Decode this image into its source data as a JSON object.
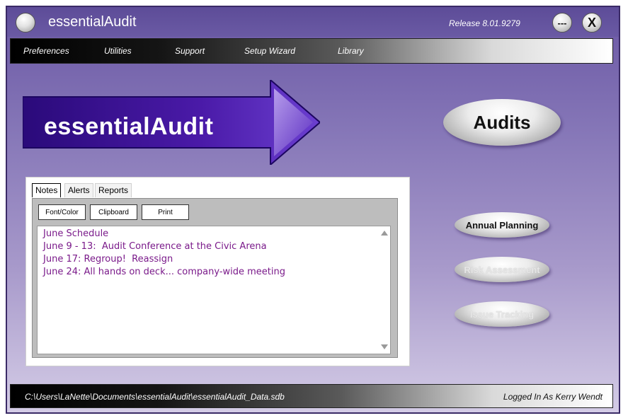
{
  "window": {
    "title": "essentialAudit",
    "release": "Release 8.01.9279",
    "minimize_label": "---",
    "close_label": "X"
  },
  "menu": {
    "items": [
      {
        "label": "Preferences"
      },
      {
        "label": "Utilities"
      },
      {
        "label": "Support"
      },
      {
        "label": "Setup Wizard"
      },
      {
        "label": "Library"
      }
    ]
  },
  "logo": {
    "text": "essentialAudit",
    "colors": {
      "dark": "#2a0a7a",
      "mid": "#5a2cc0",
      "light": "#a784e8"
    }
  },
  "buttons": {
    "audits": "Audits",
    "annual_planning": "Annual Planning",
    "risk_assessment": "Risk Assessment",
    "issue_tracking": "Issue Tracking"
  },
  "notes_panel": {
    "tabs": [
      {
        "label": "Notes",
        "active": true
      },
      {
        "label": "Alerts"
      },
      {
        "label": "Reports"
      }
    ],
    "toolbar": {
      "font_color": "Font/Color",
      "clipboard": "Clipboard",
      "print": "Print"
    },
    "lines": [
      "June Schedule",
      "June 9 - 13:  Audit Conference at the Civic Arena",
      "June 17: Regroup!  Reassign",
      "June 24: All hands on deck... company-wide meeting"
    ],
    "text_color": "#7a1a8a"
  },
  "status": {
    "path": "C:\\Users\\LaNette\\Documents\\essentialAudit\\essentialAudit_Data.sdb",
    "login": "Logged In As Kerry Wendt"
  }
}
